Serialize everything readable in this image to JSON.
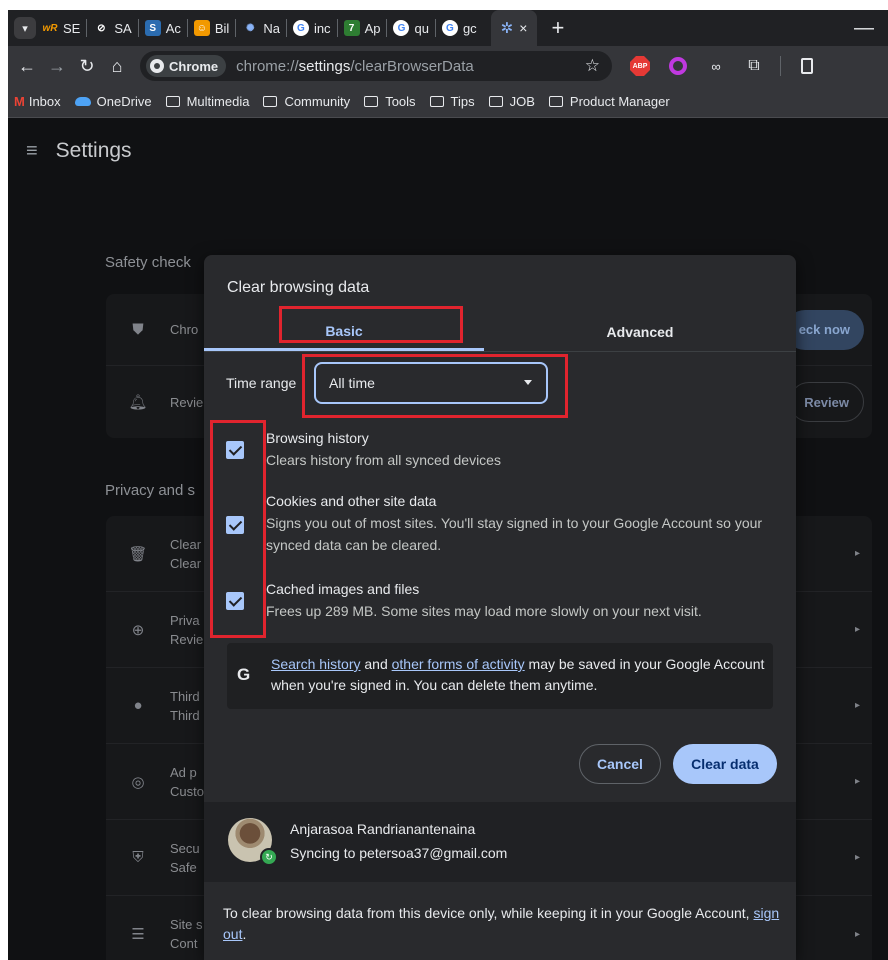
{
  "browser": {
    "tabs": [
      {
        "label": "SE",
        "icon": "wR",
        "color": "#1a73e8"
      },
      {
        "label": "SA",
        "icon": "⊘",
        "color": "#5f6368"
      },
      {
        "label": "Ac",
        "icon": "S",
        "color": "#2b6cb0"
      },
      {
        "label": "Bil",
        "icon": "☺",
        "color": "#f29900"
      },
      {
        "label": "Na",
        "icon": "✺",
        "color": "#1a73e8"
      },
      {
        "label": "inc",
        "icon": "G",
        "color": "#ffffff"
      },
      {
        "label": "Ap",
        "icon": "7",
        "color": "#2e7d32"
      },
      {
        "label": "qu",
        "icon": "G",
        "color": "#ffffff"
      },
      {
        "label": "gc",
        "icon": "G",
        "color": "#ffffff"
      }
    ],
    "active_tab_close": "×",
    "new_tab": "+",
    "minimize": "—",
    "address": {
      "chip": "Chrome",
      "url_prefix": "chrome://",
      "url_host": "settings",
      "url_path": "/clearBrowserData"
    },
    "extensions": {
      "abp": "ABP"
    },
    "bookmarks": [
      {
        "label": "Inbox",
        "icon": "gmail-icon"
      },
      {
        "label": "OneDrive",
        "icon": "cloud-icon"
      },
      {
        "label": "Multimedia",
        "icon": "folder-icon"
      },
      {
        "label": "Community",
        "icon": "folder-icon"
      },
      {
        "label": "Tools",
        "icon": "folder-icon"
      },
      {
        "label": "Tips",
        "icon": "folder-icon"
      },
      {
        "label": "JOB",
        "icon": "folder-icon"
      },
      {
        "label": "Product Manager",
        "icon": "folder-icon"
      }
    ]
  },
  "settings": {
    "title": "Settings",
    "safety_check": {
      "title": "Safety check",
      "rows": [
        {
          "text": "Chro",
          "button": "eck now"
        },
        {
          "text": "Revie",
          "button": "Review"
        }
      ]
    },
    "privacy": {
      "title": "Privacy and s",
      "rows": [
        {
          "line1": "Clear",
          "line2": "Clear"
        },
        {
          "line1": "Priva",
          "line2": "Revie"
        },
        {
          "line1": "Third",
          "line2": "Third"
        },
        {
          "line1": "Ad p",
          "line2": "Custo"
        },
        {
          "line1": "Secu",
          "line2": "Safe"
        },
        {
          "line1": "Site s",
          "line2": "Cont"
        }
      ]
    }
  },
  "dialog": {
    "title": "Clear browsing data",
    "tab_basic": "Basic",
    "tab_advanced": "Advanced",
    "time_range_label": "Time range",
    "time_range_value": "All time",
    "items": [
      {
        "title": "Browsing history",
        "desc": "Clears history from all synced devices",
        "checked": true
      },
      {
        "title": "Cookies and other site data",
        "desc": "Signs you out of most sites. You'll stay signed in to your Google Account so your synced data can be cleared.",
        "checked": true
      },
      {
        "title": "Cached images and files",
        "desc": "Frees up 289 MB. Some sites may load more slowly on your next visit.",
        "checked": true
      }
    ],
    "info": {
      "link1": "Search history",
      "text1": " and ",
      "link2": "other forms of activity",
      "text2": " may be saved in your Google Account when you're signed in. You can delete them anytime."
    },
    "cancel_label": "Cancel",
    "clear_label": "Clear data",
    "account": {
      "name": "Anjarasoa Randrianantenaina",
      "sync": "Syncing to petersoa37@gmail.com"
    },
    "footer": {
      "text": "To clear browsing data from this device only, while keeping it in your Google Account, ",
      "link": "sign out",
      "end": "."
    }
  },
  "colors": {
    "accent": "#a8c7fa",
    "annotation": "#e0242e",
    "dialog_bg": "#292a2d"
  }
}
